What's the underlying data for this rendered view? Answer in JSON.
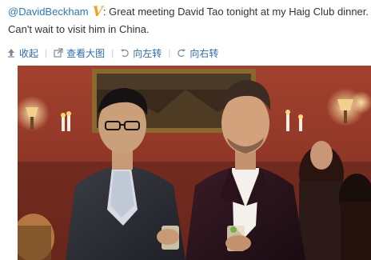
{
  "post": {
    "author": "@DavidBeckham",
    "verified_badge": "V",
    "colon": ":",
    "text": "Great meeting David Tao tonight at my Haig Club dinner. Can't wait to visit him in China."
  },
  "toolbar": {
    "collapse": "收起",
    "view_large": "查看大图",
    "rotate_left": "向左转",
    "rotate_right": "向右转",
    "separator": "|"
  },
  "icons": {
    "collapse": "collapse-up-arrow-icon",
    "view_large": "external-link-icon",
    "rotate_left": "rotate-left-icon",
    "rotate_right": "rotate-right-icon"
  },
  "colors": {
    "link": "#2b6cb3",
    "verified": "#f0a01c",
    "wall": "#9a3a2a"
  }
}
